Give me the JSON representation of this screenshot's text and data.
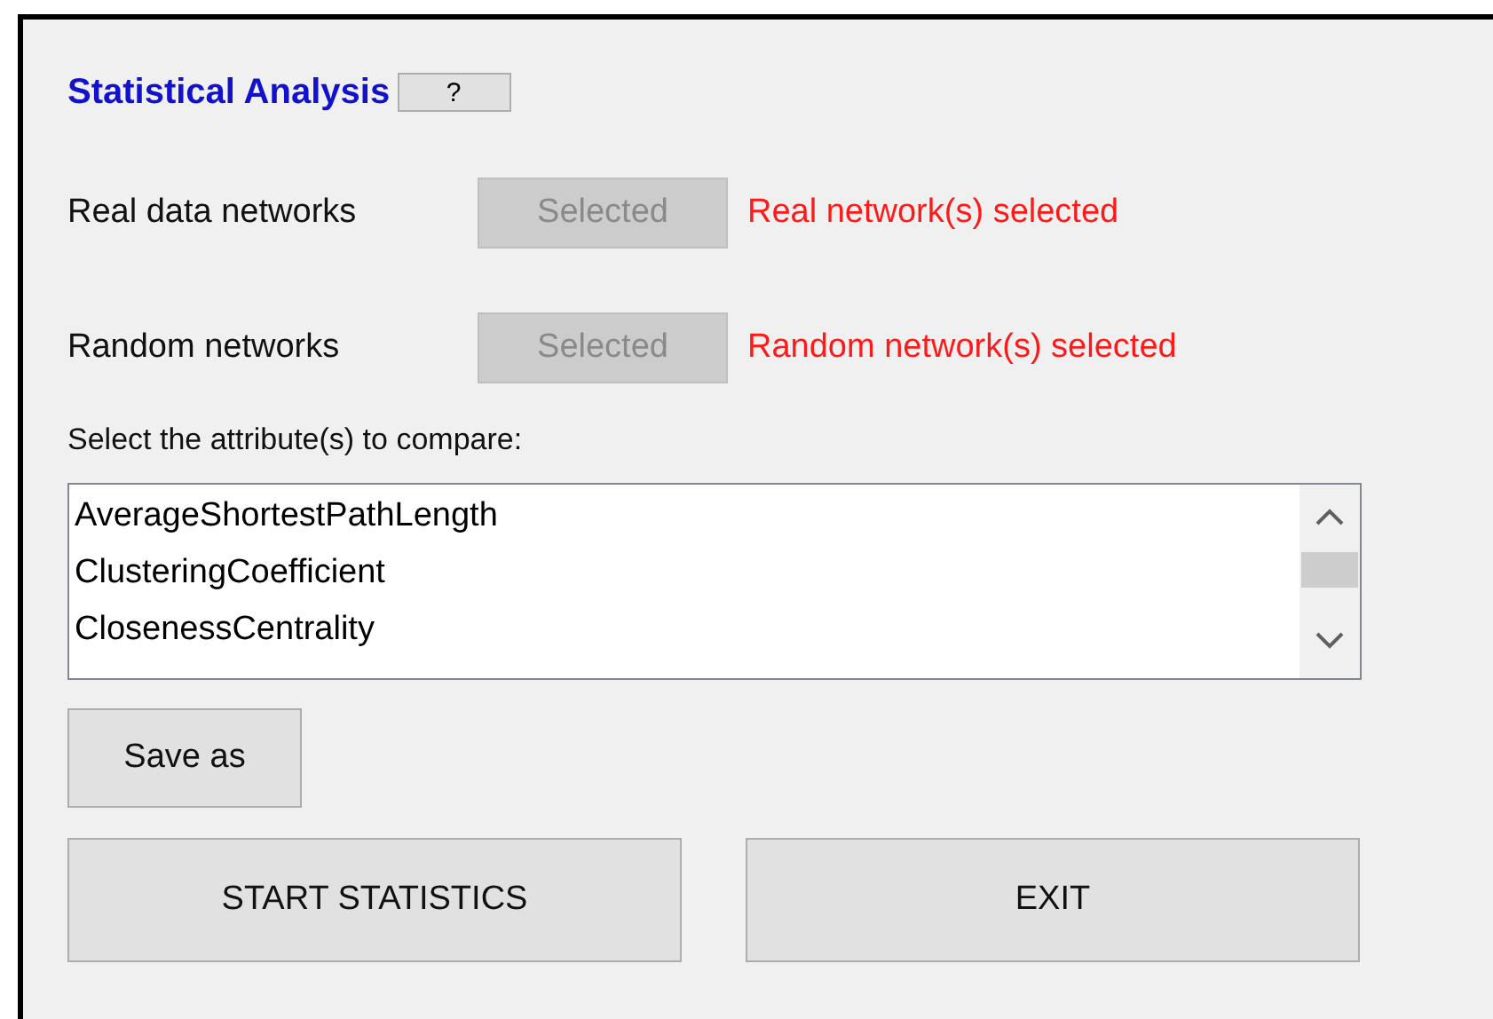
{
  "title": "Statistical Analysis",
  "help_button": "?",
  "network_rows": [
    {
      "label": "Real data networks",
      "button": "Selected",
      "disabled": true,
      "status": "Real network(s) selected"
    },
    {
      "label": "Random networks",
      "button": "Selected",
      "disabled": true,
      "status": "Random network(s) selected"
    }
  ],
  "attribute_prompt": "Select the attribute(s) to compare:",
  "attributes": [
    {
      "label": "AverageShortestPathLength",
      "selected": false
    },
    {
      "label": "ClusteringCoefficient",
      "selected": false
    },
    {
      "label": "ClosenessCentrality",
      "selected": false
    }
  ],
  "save_button": "Save as",
  "buttons": [
    "START STATISTICS",
    "EXIT"
  ]
}
